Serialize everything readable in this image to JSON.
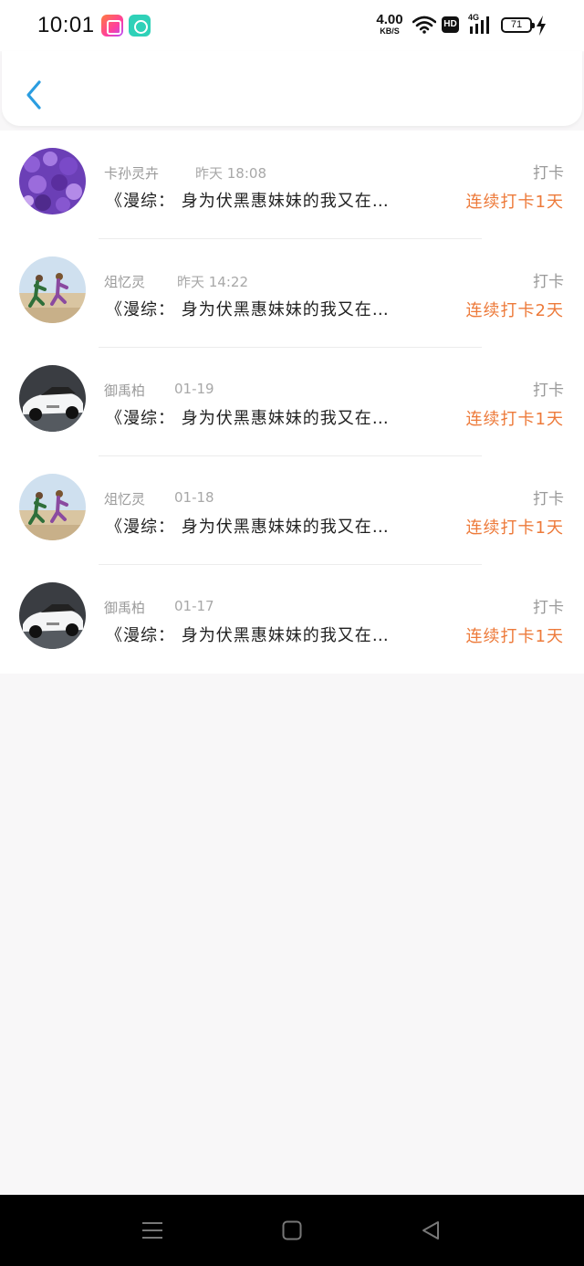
{
  "status_bar": {
    "time": "10:01",
    "net_speed_value": "4.00",
    "net_speed_unit": "KB/S",
    "hd_label": "HD",
    "signal_label": "4G",
    "battery_level": "71"
  },
  "header": {
    "back_icon": "chevron-left-icon",
    "accent_color": "#2b9de0"
  },
  "list": {
    "items": [
      {
        "name": "卡孙灵卉",
        "date": "昨天 18:08",
        "checkin_label": "打卡",
        "message": "《漫综： 身为伏黑惠妹妹的我又在…",
        "streak": "连续打卡1天",
        "avatar": "purple-flowers"
      },
      {
        "name": "俎忆灵",
        "date": "昨天 14:22",
        "checkin_label": "打卡",
        "message": "《漫综： 身为伏黑惠妹妹的我又在…",
        "streak": "连续打卡2天",
        "avatar": "running-couple"
      },
      {
        "name": "御禹柏",
        "date": "01-19",
        "checkin_label": "打卡",
        "message": "《漫综： 身为伏黑惠妹妹的我又在…",
        "streak": "连续打卡1天",
        "avatar": "white-car"
      },
      {
        "name": "俎忆灵",
        "date": "01-18",
        "checkin_label": "打卡",
        "message": "《漫综： 身为伏黑惠妹妹的我又在…",
        "streak": "连续打卡1天",
        "avatar": "running-couple"
      },
      {
        "name": "御禹柏",
        "date": "01-17",
        "checkin_label": "打卡",
        "message": "《漫综： 身为伏黑惠妹妹的我又在…",
        "streak": "连续打卡1天",
        "avatar": "white-car"
      }
    ],
    "streak_color": "#ed7a3a"
  },
  "nav_bar": {
    "buttons": [
      "menu-icon",
      "home-square-icon",
      "back-triangle-icon"
    ]
  }
}
